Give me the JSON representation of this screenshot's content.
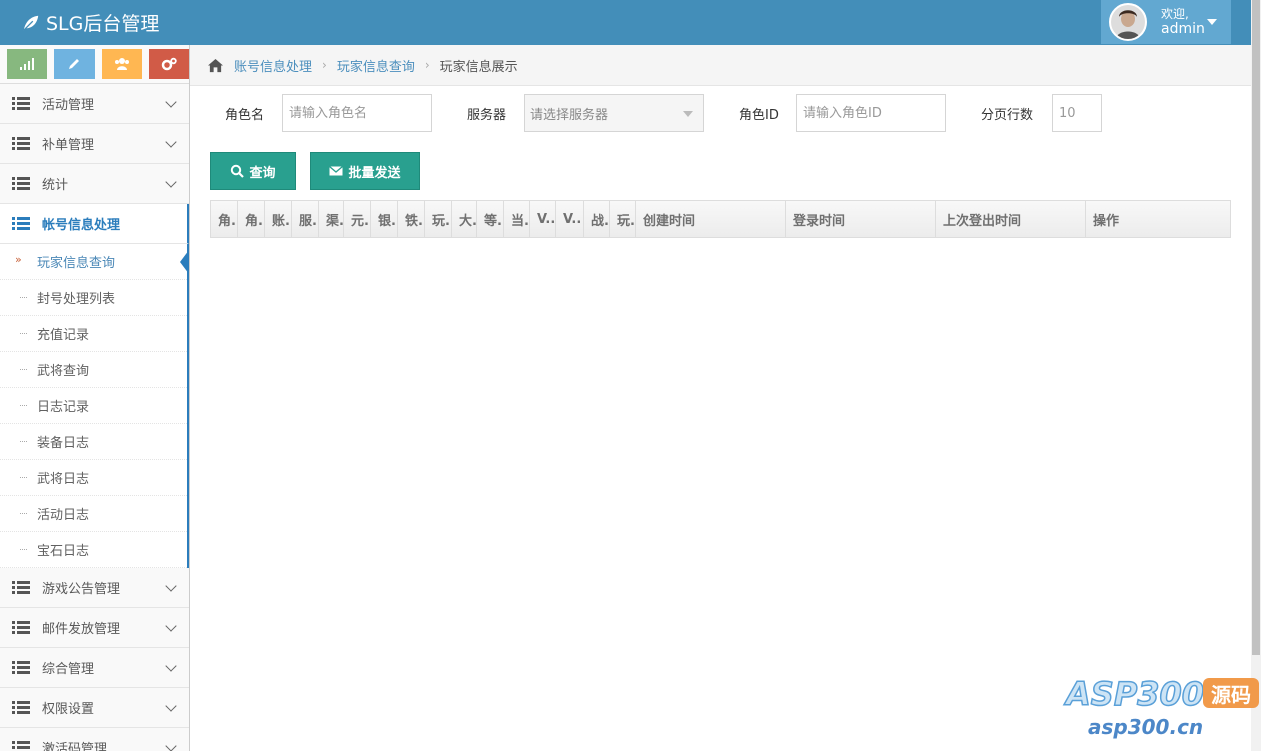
{
  "app": {
    "title": "SLG后台管理"
  },
  "user": {
    "welcome": "欢迎,",
    "name": "admin"
  },
  "sidebar": {
    "items": [
      {
        "label": "活动管理"
      },
      {
        "label": "补单管理"
      },
      {
        "label": "统计"
      },
      {
        "label": "帐号信息处理",
        "active": true
      },
      {
        "label": "游戏公告管理"
      },
      {
        "label": "邮件发放管理"
      },
      {
        "label": "综合管理"
      },
      {
        "label": "权限设置"
      },
      {
        "label": "激活码管理"
      }
    ],
    "submenu": [
      {
        "label": "玩家信息查询",
        "active": true
      },
      {
        "label": "封号处理列表"
      },
      {
        "label": "充值记录"
      },
      {
        "label": "武将查询"
      },
      {
        "label": "日志记录"
      },
      {
        "label": "装备日志"
      },
      {
        "label": "武将日志"
      },
      {
        "label": "活动日志"
      },
      {
        "label": "宝石日志"
      }
    ]
  },
  "breadcrumb": [
    "账号信息处理",
    "玩家信息查询",
    "玩家信息展示"
  ],
  "form": {
    "role_name_label": "角色名",
    "role_name_placeholder": "请输入角色名",
    "server_label": "服务器",
    "server_placeholder": "请选择服务器",
    "role_id_label": "角色ID",
    "role_id_placeholder": "请输入角色ID",
    "page_rows_label": "分页行数",
    "page_rows_value": "10"
  },
  "buttons": {
    "query": "查询",
    "batch_send": "批量发送"
  },
  "table": {
    "headers": [
      "角.",
      "角.",
      "账.",
      "服.",
      "渠.",
      "元.",
      "银.",
      "铁.",
      "玩.",
      "大.",
      "等.",
      "当.",
      "V..",
      "V..",
      "战.",
      "玩.",
      "创建时间",
      "登录时间",
      "上次登出时间",
      "操作"
    ]
  },
  "watermark": {
    "brand": "ASP300",
    "tag": "源码",
    "url": "asp300.cn"
  },
  "colors": {
    "topbar": "#438eb9",
    "accent": "#2b7dbc",
    "button": "#29a08f"
  }
}
